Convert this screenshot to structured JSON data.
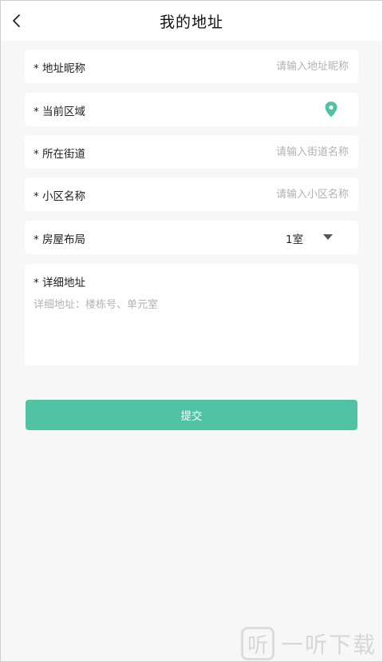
{
  "header": {
    "title": "我的地址"
  },
  "form": {
    "nickname": {
      "label": "* 地址昵称",
      "placeholder": "请输入地址昵称"
    },
    "region": {
      "label": "* 当前区域"
    },
    "street": {
      "label": "* 所在街道",
      "placeholder": "请输入街道名称"
    },
    "community": {
      "label": "* 小区名称",
      "placeholder": "请输入小区名称"
    },
    "layout": {
      "label": "* 房屋布局",
      "value": "1室"
    },
    "detail": {
      "label": "* 详细地址",
      "placeholder": "详细地址：楼栋号、单元室"
    }
  },
  "submit": {
    "label": "提交"
  },
  "colors": {
    "accent": "#4fc3a2",
    "background": "#f7f7f7"
  },
  "icons": {
    "back": "chevron-left-icon",
    "region": "location-pin-icon",
    "layout": "caret-down-icon"
  },
  "watermark": {
    "logo_char": "听",
    "text": "一听下载"
  }
}
